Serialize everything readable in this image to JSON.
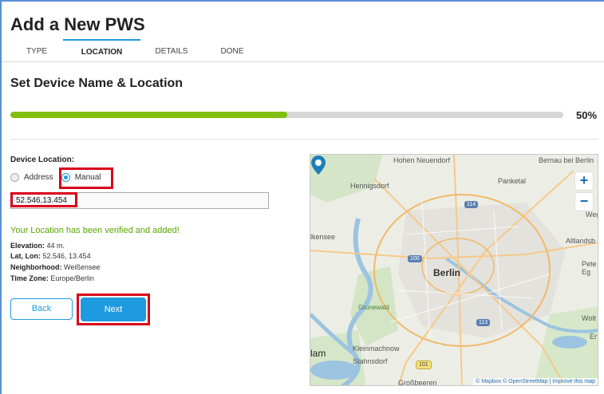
{
  "page": {
    "title": "Add a New PWS",
    "section_title": "Set Device Name & Location"
  },
  "tabs": [
    {
      "label": "TYPE",
      "active": false
    },
    {
      "label": "LOCATION",
      "active": true
    },
    {
      "label": "DETAILS",
      "active": false
    },
    {
      "label": "DONE",
      "active": false
    }
  ],
  "progress": {
    "value": 0.5,
    "label": "50%"
  },
  "location_form": {
    "label": "Device Location:",
    "radio_address": "Address",
    "radio_manual": "Manual",
    "selected": "Manual",
    "coordinates_value": "52.546,13.454"
  },
  "result": {
    "verified_message": "Your Location has been verified and added!",
    "elevation_label": "Elevation:",
    "elevation_value": "44 m.",
    "latlon_label": "Lat, Lon:",
    "latlon_value": "52.546, 13.454",
    "neighborhood_label": "Neighborhood:",
    "neighborhood_value": "Weißensee",
    "timezone_label": "Time Zone:",
    "timezone_value": "Europe/Berlin"
  },
  "buttons": {
    "back": "Back",
    "next": "Next"
  },
  "map": {
    "labels": {
      "hohen_neuendorf": "Hohen Neuendorf",
      "bernau": "Bernau bei Berlin",
      "hennigsdorf": "Hennigsdorf",
      "panketal": "Panketal",
      "wegl": "Wegl",
      "falkensee": "lkensee",
      "altlandsberg": "Altlandsb",
      "berlin": "Berlin",
      "petershagen": "Pete Eg",
      "grunewald": "Grunewald",
      "woltersdorf": "Wolt",
      "erkner": "Er",
      "potsdam": "lam",
      "kleinmachnow": "Kleinmachnow",
      "stahnsdorf": "Stahnsdorf",
      "grossbeeren": "Großbeeren"
    },
    "shields": [
      "114",
      "100",
      "113",
      "101"
    ],
    "zoom_in": "+",
    "zoom_out": "−",
    "attribution": "© Mapbox © OpenStreetMap | Improve this map"
  },
  "colors": {
    "accent": "#1e9be0",
    "progress": "#7fbf0e",
    "success": "#58a700",
    "highlight": "#d9001b"
  }
}
